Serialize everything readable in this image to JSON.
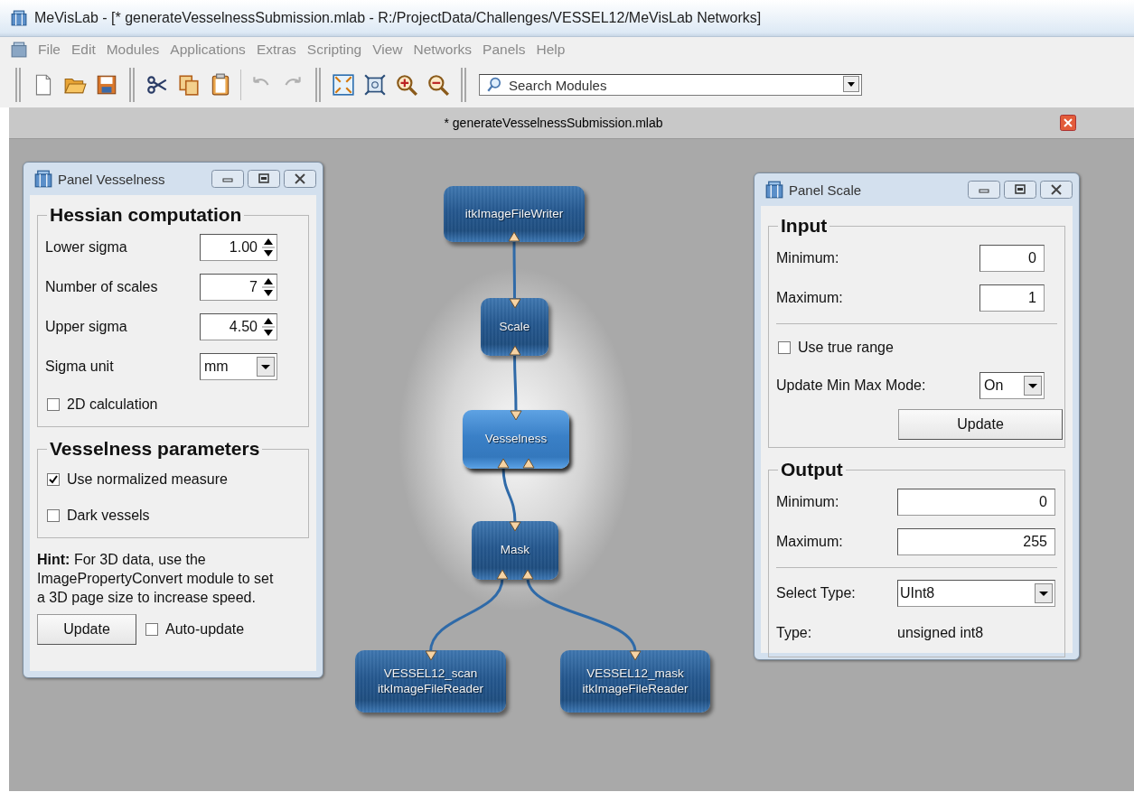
{
  "window": {
    "title": "MeVisLab - [* generateVesselnessSubmission.mlab - R:/ProjectData/Challenges/VESSEL12/MeVisLab Networks]"
  },
  "menu": [
    "File",
    "Edit",
    "Modules",
    "Applications",
    "Extras",
    "Scripting",
    "View",
    "Networks",
    "Panels",
    "Help"
  ],
  "toolbar": {
    "search": {
      "placeholder": "Search Modules"
    }
  },
  "tab": {
    "label": "* generateVesselnessSubmission.mlab"
  },
  "network": {
    "nodes": [
      {
        "lines": [
          "itkImageFileWriter"
        ],
        "selected": false
      },
      {
        "lines": [
          "Scale"
        ],
        "selected": false
      },
      {
        "lines": [
          "Vesselness"
        ],
        "selected": true
      },
      {
        "lines": [
          "Mask"
        ],
        "selected": false
      },
      {
        "lines": [
          "VESSEL12_scan",
          "itkImageFileReader"
        ],
        "selected": false
      },
      {
        "lines": [
          "VESSEL12_mask",
          "itkImageFileReader"
        ],
        "selected": false
      }
    ]
  },
  "panels": [
    {
      "title": "Panel Vesselness",
      "groups": [
        {
          "title": "Hessian computation",
          "rows": [
            {
              "kind": "spin",
              "label": "Lower sigma",
              "value": "1.00"
            },
            {
              "kind": "spin",
              "label": "Number of scales",
              "value": "7"
            },
            {
              "kind": "spin",
              "label": "Upper sigma",
              "value": "4.50"
            },
            {
              "kind": "combo",
              "label": "Sigma unit",
              "value": "mm"
            },
            {
              "kind": "check",
              "label": "2D calculation",
              "checked": false
            }
          ]
        },
        {
          "title": "Vesselness parameters",
          "rows": [
            {
              "kind": "check",
              "label": "Use normalized measure",
              "checked": true
            },
            {
              "kind": "check",
              "label": "Dark vessels",
              "checked": false
            }
          ]
        }
      ],
      "hint": "**Hint:** For 3D data, use the ImagePropertyConvert module to set a 3D page size to increase speed.",
      "footer": {
        "button": "Update",
        "check": {
          "label": "Auto-update",
          "checked": false
        }
      }
    },
    {
      "title": "Panel Scale",
      "groups": [
        {
          "title": "Input",
          "rows": [
            {
              "kind": "field",
              "label": "Minimum:",
              "value": "0"
            },
            {
              "kind": "field",
              "label": "Maximum:",
              "value": "1"
            },
            {
              "kind": "separator"
            },
            {
              "kind": "check",
              "label": "Use true range",
              "checked": false
            },
            {
              "kind": "combo",
              "label": "Update Min Max Mode:",
              "value": "On"
            },
            {
              "kind": "button",
              "label": "Update"
            }
          ]
        },
        {
          "title": "Output",
          "rows": [
            {
              "kind": "field",
              "label": "Minimum:",
              "value": "0"
            },
            {
              "kind": "field",
              "label": "Maximum:",
              "value": "255"
            },
            {
              "kind": "separator"
            },
            {
              "kind": "combo",
              "label": "Select Type:",
              "value": "UInt8"
            },
            {
              "kind": "text",
              "label": "Type:",
              "value": "unsigned int8"
            }
          ]
        }
      ]
    }
  ]
}
